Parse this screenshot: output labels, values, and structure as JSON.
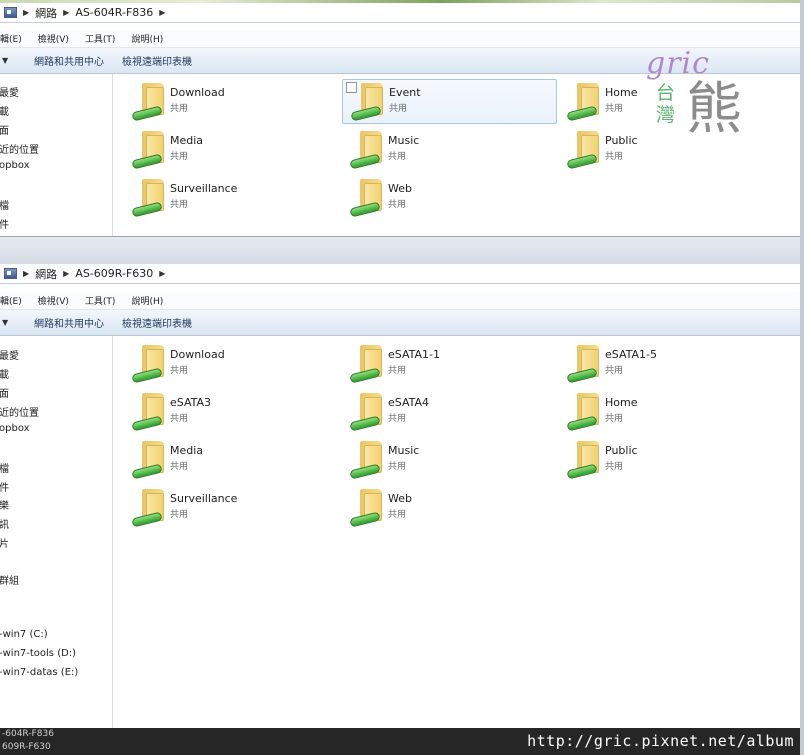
{
  "top_window": {
    "strip_text": "",
    "breadcrumb": [
      "網路",
      "AS-604R-F836"
    ],
    "menu": [
      "輯(E)",
      "檢視(V)",
      "工具(T)",
      "說明(H)"
    ],
    "toolbar": [
      "網路和共用中心",
      "檢視遠端印表機"
    ],
    "nav_items": [
      "最愛",
      "載",
      "面",
      "近的位置",
      "opbox",
      "檔",
      "件"
    ],
    "shares": [
      {
        "name": "Download",
        "type": "共用"
      },
      {
        "name": "Event",
        "type": "共用"
      },
      {
        "name": "Home",
        "type": "共用"
      },
      {
        "name": "Media",
        "type": "共用"
      },
      {
        "name": "Music",
        "type": "共用"
      },
      {
        "name": "Public",
        "type": "共用"
      },
      {
        "name": "Surveillance",
        "type": "共用"
      },
      {
        "name": "Web",
        "type": "共用"
      }
    ]
  },
  "bottom_window": {
    "breadcrumb": [
      "網路",
      "AS-609R-F630"
    ],
    "menu": [
      "輯(E)",
      "檢視(V)",
      "工具(T)",
      "說明(H)"
    ],
    "toolbar": [
      "網路和共用中心",
      "檢視遠端印表機"
    ],
    "nav_items": [
      "最愛",
      "載",
      "面",
      "近的位置",
      "opbox",
      "檔",
      "件",
      "樂",
      "訊",
      "片",
      "群組",
      "-win7 (C:)",
      "-win7-tools (D:)",
      "-win7-datas (E:)"
    ],
    "shares": [
      {
        "name": "Download",
        "type": "共用"
      },
      {
        "name": "eSATA1-1",
        "type": "共用"
      },
      {
        "name": "eSATA1-5",
        "type": "共用"
      },
      {
        "name": "eSATA3",
        "type": "共用"
      },
      {
        "name": "eSATA4",
        "type": "共用"
      },
      {
        "name": "Home",
        "type": "共用"
      },
      {
        "name": "Media",
        "type": "共用"
      },
      {
        "name": "Music",
        "type": "共用"
      },
      {
        "name": "Public",
        "type": "共用"
      },
      {
        "name": "Surveillance",
        "type": "共用"
      },
      {
        "name": "Web",
        "type": "共用"
      }
    ]
  },
  "logo": {
    "script": "gric",
    "tai": "台",
    "wan": "灣",
    "bear": "熊"
  },
  "watermark": {
    "left_lines": [
      "-604R-F836",
      "609R-F630"
    ],
    "url": "http://gric.pixnet.net/album"
  }
}
